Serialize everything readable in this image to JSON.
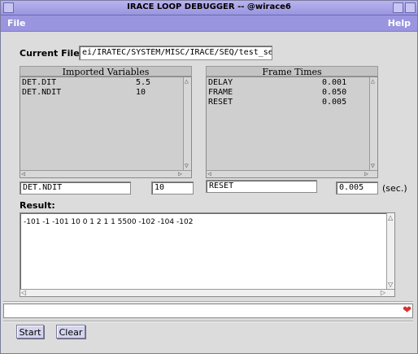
{
  "window": {
    "title": "IRACE LOOP DEBUGGER -- @wirace6"
  },
  "menu": {
    "file": "File",
    "help": "Help"
  },
  "current_file": {
    "label": "Current File :",
    "value": "ei/IRATEC/SYSTEM/MISC/IRACE/SEQ/test_seq"
  },
  "imported_variables": {
    "header": "Imported Variables",
    "rows": [
      {
        "name": "DET.DIT",
        "value": "5.5"
      },
      {
        "name": "DET.NDIT",
        "value": "10"
      }
    ],
    "selected_name": "DET.NDIT",
    "selected_value": "10"
  },
  "frame_times": {
    "header": "Frame Times",
    "rows": [
      {
        "name": "DELAY",
        "value": "0.001"
      },
      {
        "name": "FRAME",
        "value": "0.050"
      },
      {
        "name": "RESET",
        "value": "0.005"
      }
    ],
    "selected_name": "RESET",
    "selected_value": "0.005",
    "unit": "(sec.)"
  },
  "result": {
    "label": "Result:",
    "text": "-101 -1 -101 10 0 1 2 1 1 5500 -102 -104 -102"
  },
  "buttons": {
    "start": "Start",
    "clear": "Clear"
  }
}
